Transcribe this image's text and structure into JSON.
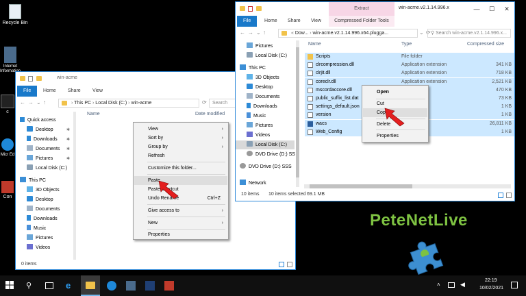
{
  "desktop": {
    "icons": [
      {
        "label": "Recycle Bin"
      },
      {
        "label": "Internet Information"
      },
      {
        "label": "c"
      },
      {
        "label": "Micr Ed"
      },
      {
        "label": "Con"
      }
    ]
  },
  "left_window": {
    "title": "win-acme",
    "tabs": [
      "File",
      "Home",
      "Share",
      "View"
    ],
    "address": [
      "This PC",
      "Local Disk (C:)",
      "win-acme"
    ],
    "search_placeholder": "Search",
    "column_name": "Name",
    "column_date": "Date modified",
    "nav": [
      {
        "label": "Quick access",
        "icon": "star-icon"
      },
      {
        "label": "Desktop",
        "icon": "desktop-icon"
      },
      {
        "label": "Downloads",
        "icon": "download-icon"
      },
      {
        "label": "Documents",
        "icon": "documents-icon"
      },
      {
        "label": "Pictures",
        "icon": "pictures-icon"
      },
      {
        "label": "Local Disk (C:)",
        "icon": "drive-icon"
      },
      {
        "label": "This PC",
        "icon": "computer-icon"
      },
      {
        "label": "3D Objects",
        "icon": "3d-objects-icon"
      },
      {
        "label": "Desktop",
        "icon": "desktop-icon"
      },
      {
        "label": "Documents",
        "icon": "documents-icon"
      },
      {
        "label": "Downloads",
        "icon": "download-icon"
      },
      {
        "label": "Music",
        "icon": "music-icon"
      },
      {
        "label": "Pictures",
        "icon": "pictures-icon"
      },
      {
        "label": "Videos",
        "icon": "videos-icon"
      }
    ],
    "status": "0 items"
  },
  "left_context_menu": {
    "items": [
      "View",
      "Sort by",
      "Group by",
      "Refresh",
      "Customize this folder...",
      "Paste",
      "Paste shortcut",
      "Undo Rename",
      "Give access to",
      "New",
      "Properties"
    ],
    "undo_shortcut": "Ctrl+Z",
    "highlighted": "Paste"
  },
  "right_window": {
    "title": "win-acme.v2.1.14.996.x",
    "ribbon_extract": "Extract",
    "compressed_tools": "Compressed Folder Tools",
    "tabs": [
      "File",
      "Home",
      "Share",
      "View"
    ],
    "address": [
      "Dow...",
      "win-acme.v2.1.14.996.x64.plugga..."
    ],
    "search_placeholder": "Search win-acme.v2.1.14.996.x...",
    "columns": {
      "name": "Name",
      "type": "Type",
      "size": "Compressed size"
    },
    "nav": [
      {
        "label": "Pictures",
        "icon": "pictures-icon"
      },
      {
        "label": "Local Disk (C:)",
        "icon": "drive-icon"
      },
      {
        "label": "This PC",
        "icon": "computer-icon"
      },
      {
        "label": "3D Objects",
        "icon": "3d-objects-icon"
      },
      {
        "label": "Desktop",
        "icon": "desktop-icon"
      },
      {
        "label": "Documents",
        "icon": "documents-icon"
      },
      {
        "label": "Downloads",
        "icon": "download-icon"
      },
      {
        "label": "Music",
        "icon": "music-icon"
      },
      {
        "label": "Pictures",
        "icon": "pictures-icon"
      },
      {
        "label": "Videos",
        "icon": "videos-icon"
      },
      {
        "label": "Local Disk (C:)",
        "icon": "drive-icon"
      },
      {
        "label": "DVD Drive (D:) SS",
        "icon": "dvd-icon"
      },
      {
        "label": "DVD Drive (D:) SSS",
        "icon": "dvd-icon"
      },
      {
        "label": "Network",
        "icon": "network-icon"
      }
    ],
    "files": [
      {
        "name": "Scripts",
        "type": "File folder",
        "size": "",
        "icon": "folder"
      },
      {
        "name": "clrcompression.dll",
        "type": "Application extension",
        "size": "341 KB",
        "icon": "dll"
      },
      {
        "name": "clrjit.dll",
        "type": "Application extension",
        "size": "718 KB",
        "icon": "dll"
      },
      {
        "name": "coreclr.dll",
        "type": "Application extension",
        "size": "2,521 KB",
        "icon": "dll"
      },
      {
        "name": "mscordaccore.dll",
        "type": "",
        "size": "470 KB",
        "icon": "dll"
      },
      {
        "name": "public_suffix_list.dat",
        "type": "",
        "size": "73 KB",
        "icon": "dll"
      },
      {
        "name": "settings_default.json",
        "type": "",
        "size": "1 KB",
        "icon": "dll"
      },
      {
        "name": "version",
        "type": "ent",
        "size": "1 KB",
        "icon": "dll"
      },
      {
        "name": "wacs",
        "type": "",
        "size": "26,811 KB",
        "icon": "exe"
      },
      {
        "name": "Web_Config",
        "type": "ent",
        "size": "1 KB",
        "icon": "dll"
      }
    ],
    "status_items": "10 items",
    "status_selected": "10 items selected",
    "status_size": "69.1 MB"
  },
  "right_context_menu": {
    "items": [
      "Open",
      "Cut",
      "Copy",
      "Delete",
      "Properties"
    ],
    "highlighted": "Copy"
  },
  "brand": {
    "text": "PeteNetLive",
    "color": "#7ec242"
  },
  "taskbar": {
    "time": "22:19",
    "date": "10/02/2021"
  }
}
